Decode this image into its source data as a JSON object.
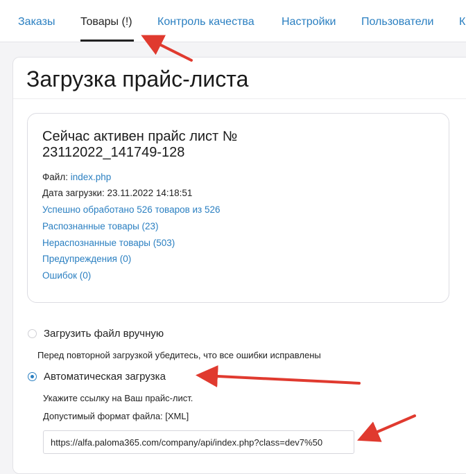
{
  "tabs": [
    {
      "label": "Заказы",
      "active": false
    },
    {
      "label": "Товары (!)",
      "active": true
    },
    {
      "label": "Контроль качества",
      "active": false
    },
    {
      "label": "Настройки",
      "active": false
    },
    {
      "label": "Пользователи",
      "active": false
    },
    {
      "label": "К",
      "active": false
    }
  ],
  "page": {
    "title": "Загрузка прайс-листа"
  },
  "pricelist": {
    "title": "Сейчас активен прайс лист № 23112022_141749-128",
    "file_label": "Файл:",
    "file_link": "index.php",
    "upload_date": "Дата загрузки: 23.11.2022 14:18:51",
    "processed": "Успешно обработано 526 товаров из 526",
    "recognized": "Распознанные товары (23)",
    "unrecognized": "Нераспознанные товары (503)",
    "warnings": "Предупреждения (0)",
    "errors": "Ошибок (0)"
  },
  "upload": {
    "manual_label": "Загрузить файл вручную",
    "manual_note": "Перед повторной загрузкой убедитесь, что все ошибки исправлены",
    "auto_label": "Автоматическая загрузка",
    "auto_note_link": "Укажите ссылку на Ваш прайс-лист.",
    "auto_note_format": "Допустимый формат файла: [XML]",
    "url_value": "https://alfa.paloma365.com/company/api/index.php?class=dev7%50",
    "selected": "auto"
  },
  "colors": {
    "link": "#2a7fc1",
    "arrow": "#e03a2f"
  }
}
